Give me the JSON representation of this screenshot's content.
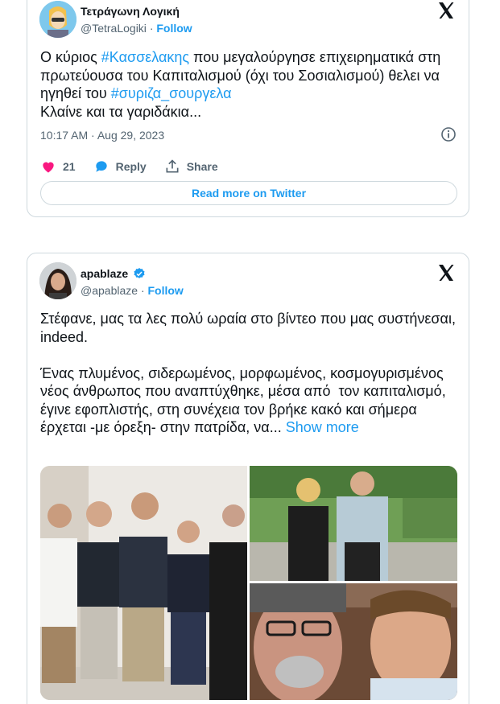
{
  "tweets": [
    {
      "author": {
        "name": "Τετράγωνη Λογική",
        "handle": "@TetraLogiki",
        "separator": "·",
        "follow_label": "Follow"
      },
      "text": {
        "p1": "Ο κύριος ",
        "tag1": "#Κασσελακης",
        "p2": " που μεγαλούργησε επιχειρηματικά στη πρωτεύουσα του Καπιταλισμού (όχι του Σοσιαλισμού) θελει να ηγηθεί του ",
        "tag2": "#συριζα_σουργελα",
        "p3": "\nΚλαίνε και τα γαριδάκια..."
      },
      "timestamp": "10:17 AM · Aug 29, 2023",
      "likes": "21",
      "reply_label": "Reply",
      "share_label": "Share",
      "read_more_label": "Read more on Twitter"
    },
    {
      "author": {
        "name": "apablaze",
        "handle": "@apablaze",
        "separator": "·",
        "follow_label": "Follow",
        "verified": true
      },
      "text": {
        "body": "Στέφανε, μας τα λες πολύ ωραία στο βίντεο που μας συστήνεσαι, indeed.\n\nΈνας πλυμένος, σιδερωμένος, μορφωμένος, κοσμογυρισμένος νέος άνθρωπος που αναπτύχθηκε, μέσα από  τον καπιταλισμό, έγινε εφοπλιστής, στη συνέχεια τον βρήκε κακό και σήμερα έρχεται -με όρεξη- στην πατρίδα, να... ",
        "show_more": "Show more"
      },
      "photos": [
        "group-photo",
        "couple-photo",
        "selfie-photo"
      ]
    }
  ],
  "colors": {
    "accent": "#1d9bf0",
    "like": "#f91880",
    "verified": "#1d9bf0",
    "text": "#0f1419",
    "muted": "#536471",
    "border": "#cfd9de"
  },
  "icons": [
    "x-logo-icon",
    "info-icon",
    "heart-icon",
    "reply-bubble-icon",
    "share-upload-icon",
    "verified-badge-icon"
  ]
}
